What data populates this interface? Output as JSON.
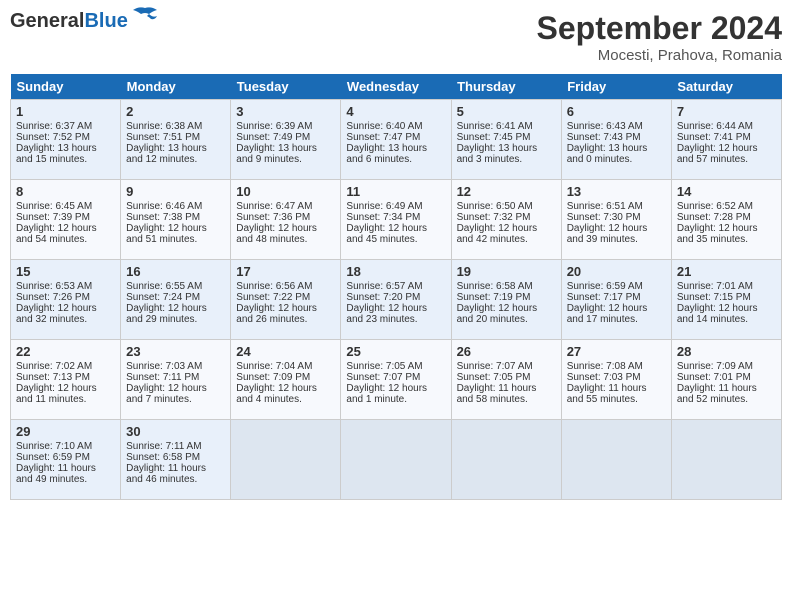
{
  "header": {
    "logo_general": "General",
    "logo_blue": "Blue",
    "month_title": "September 2024",
    "location": "Mocesti, Prahova, Romania"
  },
  "days_of_week": [
    "Sunday",
    "Monday",
    "Tuesday",
    "Wednesday",
    "Thursday",
    "Friday",
    "Saturday"
  ],
  "weeks": [
    [
      {
        "num": "1",
        "sunrise": "Sunrise: 6:37 AM",
        "sunset": "Sunset: 7:52 PM",
        "daylight": "Daylight: 13 hours and 15 minutes."
      },
      {
        "num": "2",
        "sunrise": "Sunrise: 6:38 AM",
        "sunset": "Sunset: 7:51 PM",
        "daylight": "Daylight: 13 hours and 12 minutes."
      },
      {
        "num": "3",
        "sunrise": "Sunrise: 6:39 AM",
        "sunset": "Sunset: 7:49 PM",
        "daylight": "Daylight: 13 hours and 9 minutes."
      },
      {
        "num": "4",
        "sunrise": "Sunrise: 6:40 AM",
        "sunset": "Sunset: 7:47 PM",
        "daylight": "Daylight: 13 hours and 6 minutes."
      },
      {
        "num": "5",
        "sunrise": "Sunrise: 6:41 AM",
        "sunset": "Sunset: 7:45 PM",
        "daylight": "Daylight: 13 hours and 3 minutes."
      },
      {
        "num": "6",
        "sunrise": "Sunrise: 6:43 AM",
        "sunset": "Sunset: 7:43 PM",
        "daylight": "Daylight: 13 hours and 0 minutes."
      },
      {
        "num": "7",
        "sunrise": "Sunrise: 6:44 AM",
        "sunset": "Sunset: 7:41 PM",
        "daylight": "Daylight: 12 hours and 57 minutes."
      }
    ],
    [
      {
        "num": "8",
        "sunrise": "Sunrise: 6:45 AM",
        "sunset": "Sunset: 7:39 PM",
        "daylight": "Daylight: 12 hours and 54 minutes."
      },
      {
        "num": "9",
        "sunrise": "Sunrise: 6:46 AM",
        "sunset": "Sunset: 7:38 PM",
        "daylight": "Daylight: 12 hours and 51 minutes."
      },
      {
        "num": "10",
        "sunrise": "Sunrise: 6:47 AM",
        "sunset": "Sunset: 7:36 PM",
        "daylight": "Daylight: 12 hours and 48 minutes."
      },
      {
        "num": "11",
        "sunrise": "Sunrise: 6:49 AM",
        "sunset": "Sunset: 7:34 PM",
        "daylight": "Daylight: 12 hours and 45 minutes."
      },
      {
        "num": "12",
        "sunrise": "Sunrise: 6:50 AM",
        "sunset": "Sunset: 7:32 PM",
        "daylight": "Daylight: 12 hours and 42 minutes."
      },
      {
        "num": "13",
        "sunrise": "Sunrise: 6:51 AM",
        "sunset": "Sunset: 7:30 PM",
        "daylight": "Daylight: 12 hours and 39 minutes."
      },
      {
        "num": "14",
        "sunrise": "Sunrise: 6:52 AM",
        "sunset": "Sunset: 7:28 PM",
        "daylight": "Daylight: 12 hours and 35 minutes."
      }
    ],
    [
      {
        "num": "15",
        "sunrise": "Sunrise: 6:53 AM",
        "sunset": "Sunset: 7:26 PM",
        "daylight": "Daylight: 12 hours and 32 minutes."
      },
      {
        "num": "16",
        "sunrise": "Sunrise: 6:55 AM",
        "sunset": "Sunset: 7:24 PM",
        "daylight": "Daylight: 12 hours and 29 minutes."
      },
      {
        "num": "17",
        "sunrise": "Sunrise: 6:56 AM",
        "sunset": "Sunset: 7:22 PM",
        "daylight": "Daylight: 12 hours and 26 minutes."
      },
      {
        "num": "18",
        "sunrise": "Sunrise: 6:57 AM",
        "sunset": "Sunset: 7:20 PM",
        "daylight": "Daylight: 12 hours and 23 minutes."
      },
      {
        "num": "19",
        "sunrise": "Sunrise: 6:58 AM",
        "sunset": "Sunset: 7:19 PM",
        "daylight": "Daylight: 12 hours and 20 minutes."
      },
      {
        "num": "20",
        "sunrise": "Sunrise: 6:59 AM",
        "sunset": "Sunset: 7:17 PM",
        "daylight": "Daylight: 12 hours and 17 minutes."
      },
      {
        "num": "21",
        "sunrise": "Sunrise: 7:01 AM",
        "sunset": "Sunset: 7:15 PM",
        "daylight": "Daylight: 12 hours and 14 minutes."
      }
    ],
    [
      {
        "num": "22",
        "sunrise": "Sunrise: 7:02 AM",
        "sunset": "Sunset: 7:13 PM",
        "daylight": "Daylight: 12 hours and 11 minutes."
      },
      {
        "num": "23",
        "sunrise": "Sunrise: 7:03 AM",
        "sunset": "Sunset: 7:11 PM",
        "daylight": "Daylight: 12 hours and 7 minutes."
      },
      {
        "num": "24",
        "sunrise": "Sunrise: 7:04 AM",
        "sunset": "Sunset: 7:09 PM",
        "daylight": "Daylight: 12 hours and 4 minutes."
      },
      {
        "num": "25",
        "sunrise": "Sunrise: 7:05 AM",
        "sunset": "Sunset: 7:07 PM",
        "daylight": "Daylight: 12 hours and 1 minute."
      },
      {
        "num": "26",
        "sunrise": "Sunrise: 7:07 AM",
        "sunset": "Sunset: 7:05 PM",
        "daylight": "Daylight: 11 hours and 58 minutes."
      },
      {
        "num": "27",
        "sunrise": "Sunrise: 7:08 AM",
        "sunset": "Sunset: 7:03 PM",
        "daylight": "Daylight: 11 hours and 55 minutes."
      },
      {
        "num": "28",
        "sunrise": "Sunrise: 7:09 AM",
        "sunset": "Sunset: 7:01 PM",
        "daylight": "Daylight: 11 hours and 52 minutes."
      }
    ],
    [
      {
        "num": "29",
        "sunrise": "Sunrise: 7:10 AM",
        "sunset": "Sunset: 6:59 PM",
        "daylight": "Daylight: 11 hours and 49 minutes."
      },
      {
        "num": "30",
        "sunrise": "Sunrise: 7:11 AM",
        "sunset": "Sunset: 6:58 PM",
        "daylight": "Daylight: 11 hours and 46 minutes."
      },
      null,
      null,
      null,
      null,
      null
    ]
  ]
}
